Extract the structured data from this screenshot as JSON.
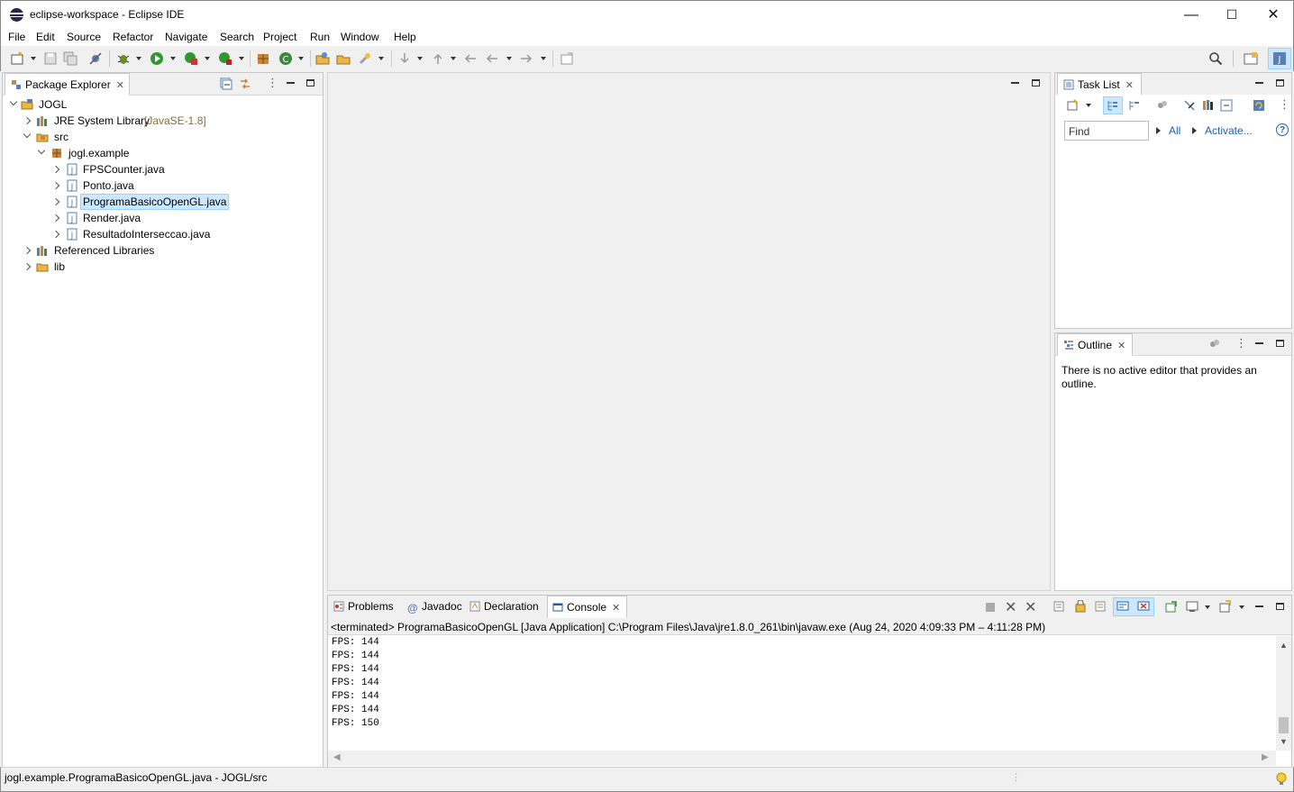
{
  "window": {
    "title": "eclipse-workspace - Eclipse IDE",
    "controls": {
      "minimize": "—",
      "maximize": "☐",
      "close": "✕"
    }
  },
  "menu": [
    "File",
    "Edit",
    "Source",
    "Refactor",
    "Navigate",
    "Search",
    "Project",
    "Run",
    "Window",
    "Help"
  ],
  "package_explorer": {
    "tab_label": "Package Explorer",
    "tree": {
      "project": "JOGL",
      "jre": {
        "label": "JRE System Library",
        "detail": "[JavaSE-1.8]"
      },
      "src": "src",
      "package": "jogl.example",
      "files": [
        "FPSCounter.java",
        "Ponto.java",
        "ProgramaBasicoOpenGL.java",
        "Render.java",
        "ResultadoInterseccao.java"
      ],
      "selected_file": "ProgramaBasicoOpenGL.java",
      "referenced_libraries": "Referenced Libraries",
      "lib": "lib"
    }
  },
  "task_list": {
    "tab_label": "Task List",
    "find_placeholder": "Find",
    "all_label": "All",
    "activate_label": "Activate...",
    "help_glyph": "?"
  },
  "outline": {
    "tab_label": "Outline",
    "message": "There is no active editor that provides an outline."
  },
  "bottom_panel": {
    "tabs": [
      "Problems",
      "Javadoc",
      "Declaration",
      "Console"
    ],
    "active_tab": "Console",
    "console_header": "<terminated> ProgramaBasicoOpenGL [Java Application] C:\\Program Files\\Java\\jre1.8.0_261\\bin\\javaw.exe  (Aug 24, 2020 4:09:33 PM – 4:11:28 PM)",
    "output_lines": [
      "FPS: 144",
      "FPS: 144",
      "FPS: 144",
      "FPS: 144",
      "FPS: 144",
      "FPS: 144",
      "FPS: 150"
    ]
  },
  "status_bar": {
    "text": "jogl.example.ProgramaBasicoOpenGL.java - JOGL/src"
  },
  "colors": {
    "accent_blue": "#1a5fb4",
    "selection": "#cce8ff",
    "package_brown": "#8a6d3b"
  },
  "icons": [
    "eclipse-logo-icon",
    "new-icon",
    "save-icon",
    "save-all-icon",
    "debug-icon",
    "run-icon",
    "coverage-icon",
    "external-tools-icon",
    "new-java-package-icon",
    "new-java-class-icon",
    "open-type-icon",
    "search-icon",
    "perspective-icon",
    "java-perspective-icon"
  ]
}
